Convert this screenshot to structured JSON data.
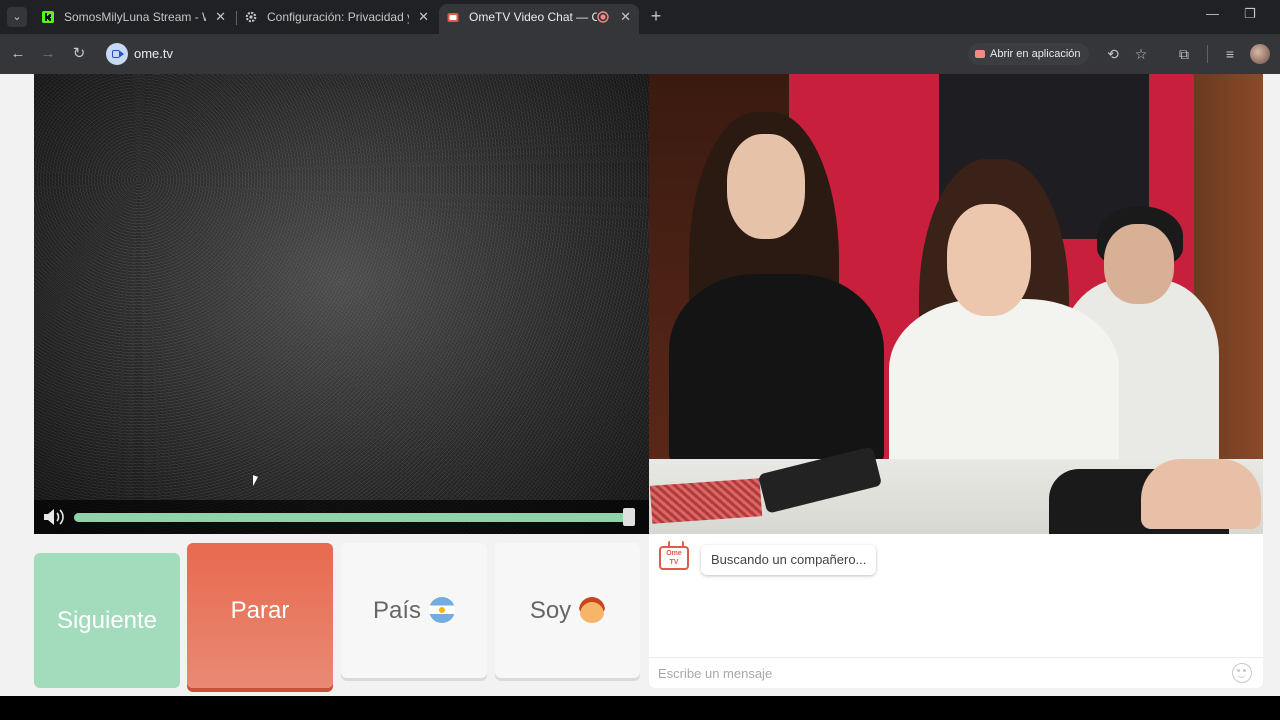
{
  "browser": {
    "tabs": [
      {
        "title": "SomosMilyLuna Stream - Watc",
        "favicon": "kick-icon",
        "active": false
      },
      {
        "title": "Configuración: Privacidad y seg",
        "favicon": "gear-icon",
        "active": false
      },
      {
        "title": "OmeTV Video Chat — Ome",
        "favicon": "ometv-icon",
        "active": true,
        "recording": true
      }
    ],
    "tab_close": "✕",
    "new_tab": "+",
    "url": "ome.tv",
    "open_in_app": "Abrir en aplicación",
    "accent": "#8ab4f8"
  },
  "player": {
    "volume": 1.0,
    "volume_color": "#8fd3a8"
  },
  "controls": {
    "next_label": "Siguiente",
    "stop_label": "Parar",
    "country_label": "País",
    "country_flag": "argentina-flag-icon",
    "iam_label": "Soy",
    "iam_icon": "boy-emoji-icon"
  },
  "chat": {
    "logo_text": "Ome TV",
    "status_message": "Buscando un compañero...",
    "input_placeholder": "Escribe un mensaje"
  },
  "colors": {
    "next": "#a3dbbd",
    "stop": "#e8694f",
    "neutral": "#f7f7f7"
  }
}
